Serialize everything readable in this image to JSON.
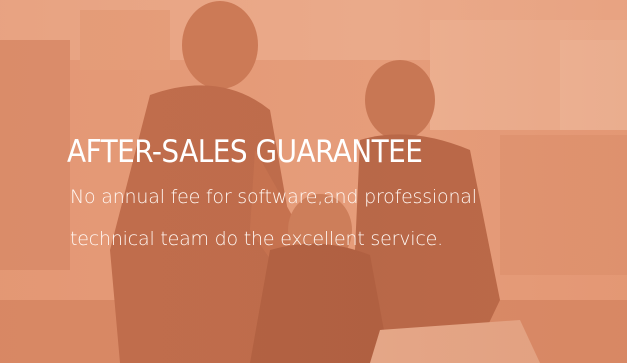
{
  "banner": {
    "heading": "AFTER-SALES GUARANTEE",
    "description_lines": [
      "No annual fee for software,and professional",
      "technical team do the excellent service."
    ]
  },
  "colors": {
    "tint": "#e6a383",
    "text": "#ffffff"
  },
  "photo": {
    "subject": "team-of-three-people-icon"
  }
}
